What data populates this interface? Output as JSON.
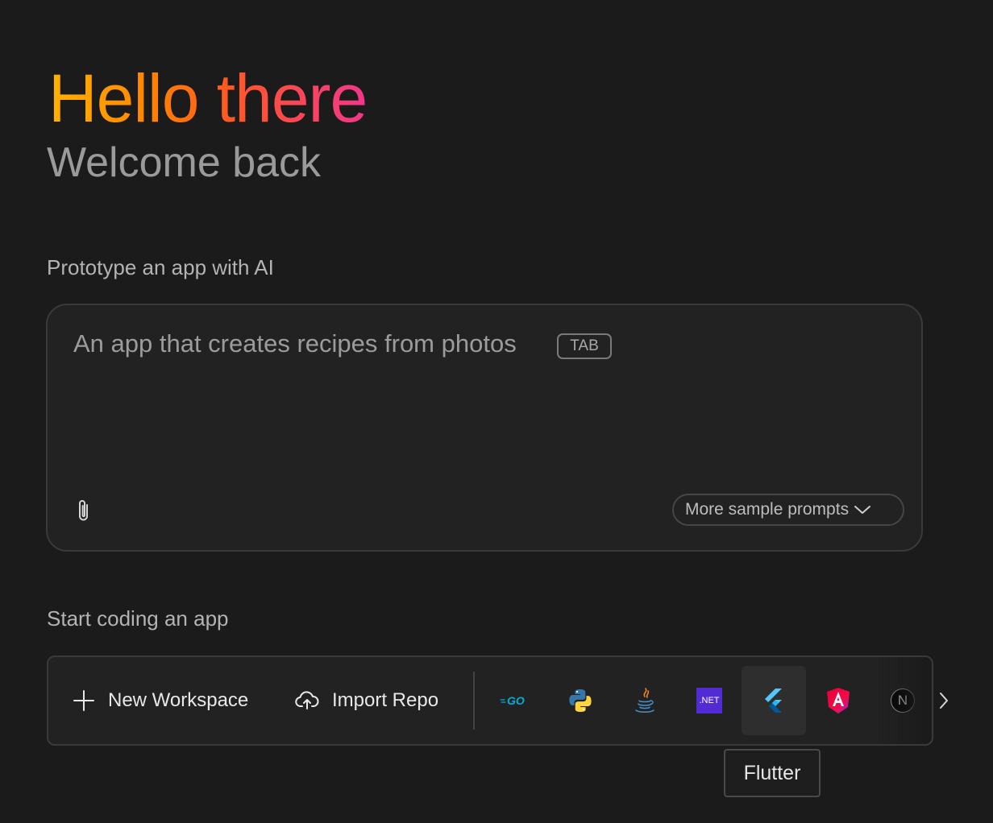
{
  "hero": {
    "title": "Hello there",
    "subtitle": "Welcome back"
  },
  "prototype_section": {
    "label": "Prototype an app with AI",
    "placeholder": "An app that creates recipes from photos",
    "tab_hint": "TAB",
    "attach_icon": "paperclip-icon",
    "more_prompts_label": "More sample prompts",
    "more_prompts_icon": "chevron-down-icon"
  },
  "coding_section": {
    "label": "Start coding an app",
    "new_workspace_label": "New Workspace",
    "new_workspace_icon": "plus-icon",
    "import_repo_label": "Import Repo",
    "import_repo_icon": "cloud-upload-icon",
    "templates": [
      {
        "name": "Go",
        "icon": "go-icon"
      },
      {
        "name": "Python",
        "icon": "python-icon"
      },
      {
        "name": "Java",
        "icon": "java-icon"
      },
      {
        "name": ".NET",
        "icon": "dotnet-icon",
        "text": ".NET"
      },
      {
        "name": "Flutter",
        "icon": "flutter-icon",
        "hovered": true
      },
      {
        "name": "Angular",
        "icon": "angular-icon"
      },
      {
        "name": "Next.js",
        "icon": "nextjs-icon",
        "text": "N"
      }
    ],
    "next_icon": "chevron-right-icon",
    "tooltip": "Flutter"
  },
  "colors": {
    "background": "#1b1b1b",
    "panel": "#222222",
    "gradient_start": "#ffb300",
    "gradient_end": "#f2368a",
    "go_blue": "#00add8",
    "dotnet_purple": "#512bd4",
    "flutter_blue": "#42a5f5",
    "angular_magenta": "#e40035"
  }
}
